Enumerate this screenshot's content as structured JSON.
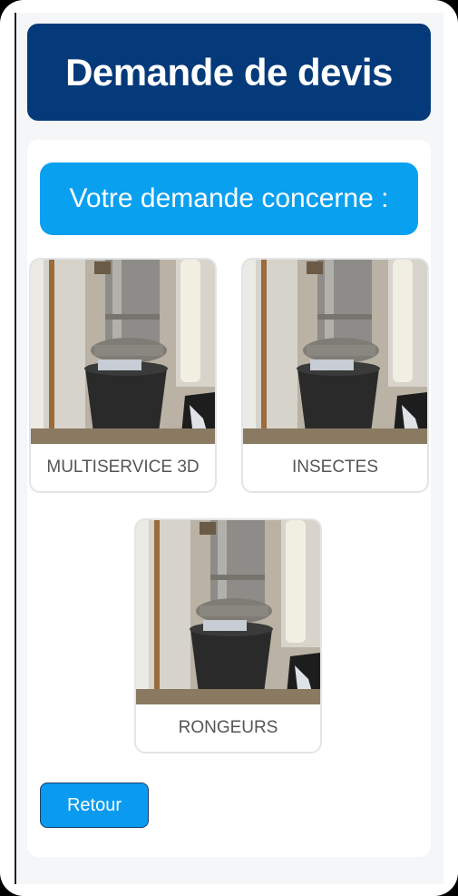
{
  "header": {
    "title": "Demande de devis"
  },
  "question": {
    "text": "Votre demande concerne :"
  },
  "options": [
    {
      "label": "MULTISERVICE 3D"
    },
    {
      "label": "INSECTES"
    },
    {
      "label": "RONGEURS"
    }
  ],
  "actions": {
    "back_label": "Retour"
  },
  "colors": {
    "header_bg": "#053a7a",
    "accent": "#0aa0f0"
  }
}
